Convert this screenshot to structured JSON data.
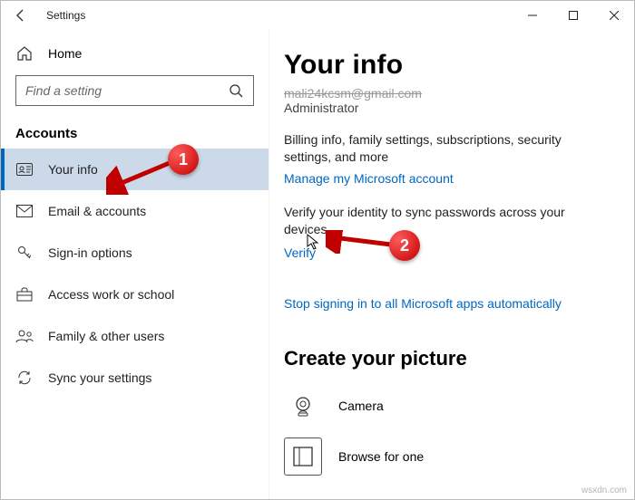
{
  "window": {
    "title": "Settings"
  },
  "sidebar": {
    "home_label": "Home",
    "search_placeholder": "Find a setting",
    "section_label": "Accounts",
    "items": [
      {
        "label": "Your info"
      },
      {
        "label": "Email & accounts"
      },
      {
        "label": "Sign-in options"
      },
      {
        "label": "Access work or school"
      },
      {
        "label": "Family & other users"
      },
      {
        "label": "Sync your settings"
      }
    ]
  },
  "content": {
    "heading": "Your info",
    "email_struck": "mali24kcsm@gmail.com",
    "role": "Administrator",
    "billing_para": "Billing info, family settings, subscriptions, security settings, and more",
    "manage_link": "Manage my Microsoft account",
    "verify_para": "Verify your identity to sync passwords across your devices.",
    "verify_link": "Verify",
    "stop_link": "Stop signing in to all Microsoft apps automatically",
    "picture_heading": "Create your picture",
    "camera_label": "Camera",
    "browse_label": "Browse for one"
  },
  "annotations": {
    "badge1": "1",
    "badge2": "2"
  },
  "watermark": "wsxdn.com"
}
